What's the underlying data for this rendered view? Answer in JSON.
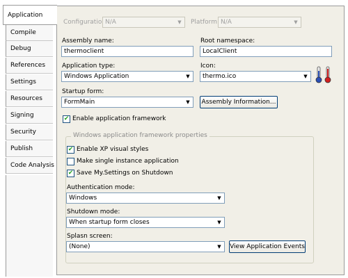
{
  "tabs": [
    {
      "label": "Application",
      "active": true
    },
    {
      "label": "Compile"
    },
    {
      "label": "Debug"
    },
    {
      "label": "References"
    },
    {
      "label": "Settings"
    },
    {
      "label": "Resources"
    },
    {
      "label": "Signing"
    },
    {
      "label": "Security"
    },
    {
      "label": "Publish"
    },
    {
      "label": "Code Analysis"
    }
  ],
  "top": {
    "configuration_label": "Configuration:",
    "configuration_value": "N/A",
    "platform_label": "Platform:",
    "platform_value": "N/A"
  },
  "fields": {
    "assembly_name_label": "Assembly name:",
    "assembly_name_value": "thermoclient",
    "root_namespace_label": "Root namespace:",
    "root_namespace_value": "LocalClient",
    "application_type_label": "Application type:",
    "application_type_value": "Windows Application",
    "icon_label": "Icon:",
    "icon_value": "thermo.ico",
    "startup_form_label": "Startup form:",
    "startup_form_value": "FormMain",
    "assembly_info_button": "Assembly Information...",
    "enable_framework_label": "Enable application framework",
    "enable_framework_checked": true
  },
  "framework_group": {
    "title": "Windows application framework properties",
    "xp_styles_label": "Enable XP visual styles",
    "xp_styles_checked": true,
    "single_instance_label": "Make single instance application",
    "single_instance_checked": false,
    "save_settings_label": "Save My.Settings on Shutdown",
    "save_settings_checked": true,
    "auth_mode_label": "Authentication mode:",
    "auth_mode_value": "Windows",
    "shutdown_mode_label": "Shutdown mode:",
    "shutdown_mode_value": "When startup form closes",
    "splash_screen_label": "Splasn screen:",
    "splash_screen_value": "(None)",
    "view_events_button": "View Application Events"
  },
  "check_mark": "✔",
  "dropdown_arrow": "▼",
  "colors": {
    "panel_bg": "#f1efe7",
    "check_green": "#21a121",
    "thermo_blue": "#2a4fb5",
    "thermo_red": "#d12020"
  }
}
